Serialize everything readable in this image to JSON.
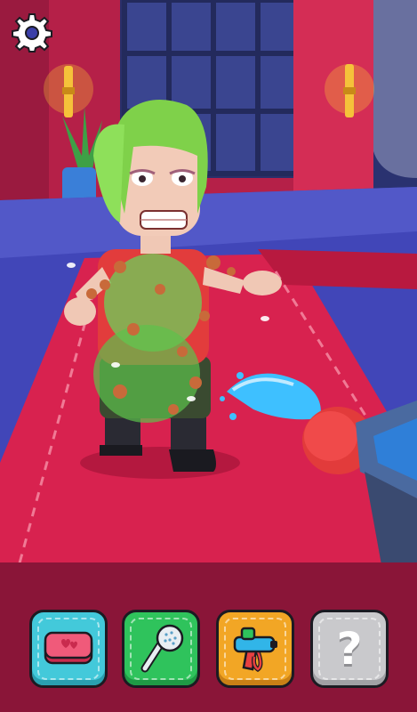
{
  "hud": {
    "settings_icon": "gear-icon"
  },
  "tools": [
    {
      "id": "soap",
      "icon": "soap-bar-icon",
      "state": "available",
      "color": "#43c9da"
    },
    {
      "id": "shower",
      "icon": "shower-head-icon",
      "state": "available",
      "color": "#2fc35c"
    },
    {
      "id": "water-gun",
      "icon": "water-gun-icon",
      "state": "available",
      "color": "#f2a625"
    },
    {
      "id": "locked",
      "icon": "question-mark-icon",
      "state": "locked",
      "color": "#c9c9cc",
      "label": "?"
    }
  ],
  "colors": {
    "carpet": "#d8224f",
    "floor": "#4146b8",
    "wall": "#c4284f",
    "water": "#3ec0ff",
    "grime": "#6bd05a",
    "tray": "#8a1538"
  }
}
